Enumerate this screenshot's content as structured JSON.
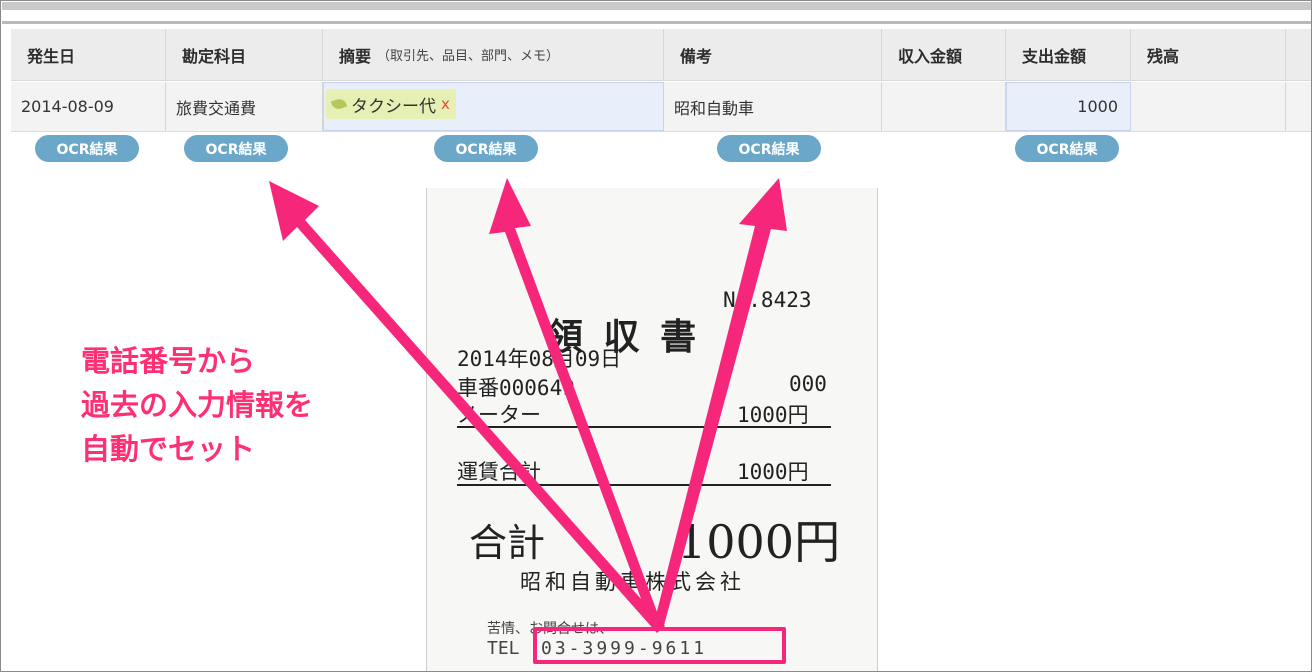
{
  "table": {
    "headers": {
      "date": "発生日",
      "account": "勘定科目",
      "summary": "摘要",
      "summary_sub": "（取引先、品目、部門、メモ）",
      "note": "備考",
      "income": "収入金額",
      "expense": "支出金額",
      "balance": "残高"
    },
    "row": {
      "date": "2014-08-09",
      "account": "旅費交通費",
      "summary_tag": "タクシー代",
      "summary_tag_remove": "x",
      "note": "昭和自動車",
      "income": "",
      "expense": "1000",
      "balance": ""
    }
  },
  "ocr_buttons": [
    "OCR結果",
    "OCR結果",
    "OCR結果",
    "OCR結果",
    "OCR結果"
  ],
  "receipt": {
    "number": "No.8423",
    "title": "領 収 書",
    "date": "2014年08月09日",
    "car_no": "車番000649",
    "car_code": "000",
    "meter_label": "メーター",
    "meter_value": "1000円",
    "fare_label": "運賃合計",
    "fare_value": "1000円",
    "total_label": "合計",
    "total_value": "1000円",
    "company": "昭和自動車株式会社",
    "contact_label": "苦情、お問合せは、",
    "tel_label": "TEL",
    "tel": "03-3999-9611"
  },
  "annotation": {
    "lines": [
      "電話番号から",
      "過去の入力情報を",
      "自動でセット"
    ],
    "color": "#ff2f73"
  },
  "colors": {
    "ocr_button": "#6aa7c8",
    "tag_bg": "#e6efb4",
    "arrow": "#f6277a"
  }
}
